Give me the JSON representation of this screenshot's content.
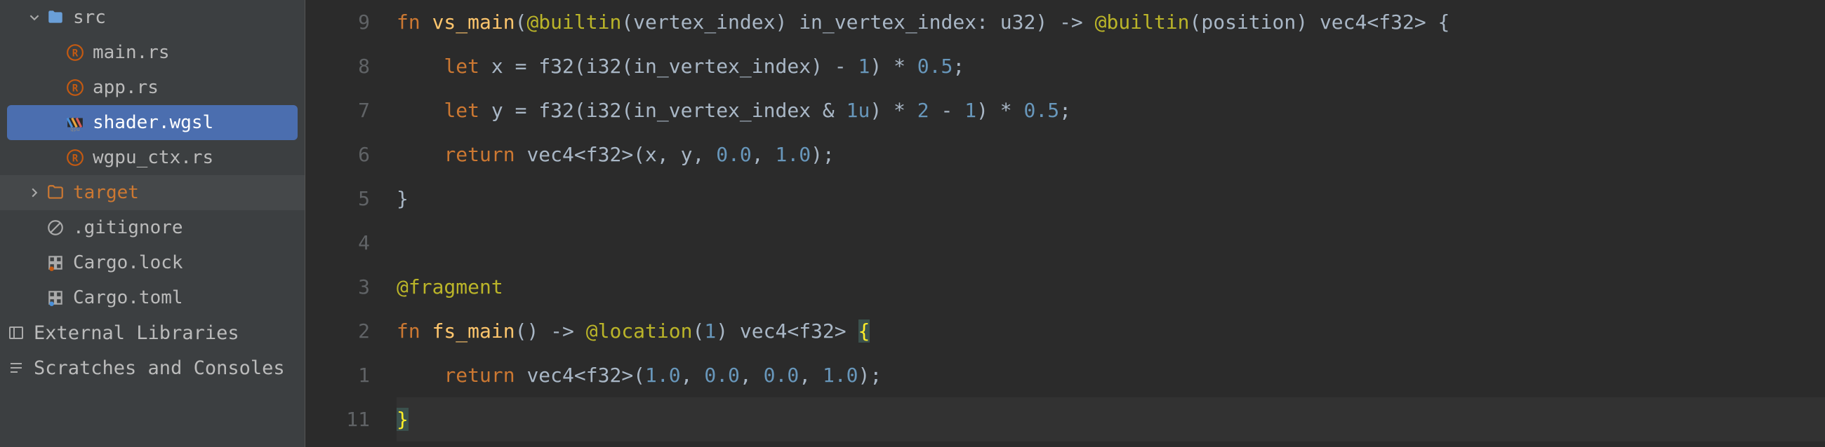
{
  "sidebar": {
    "items": [
      {
        "label": "src",
        "type": "folder",
        "expanded": true,
        "indent": 1,
        "color": "normal",
        "icon": "folder"
      },
      {
        "label": "main.rs",
        "type": "file",
        "indent": 2,
        "icon": "rust"
      },
      {
        "label": "app.rs",
        "type": "file",
        "indent": 2,
        "icon": "rust"
      },
      {
        "label": "shader.wgsl",
        "type": "file",
        "indent": 2,
        "icon": "shader",
        "selected": true
      },
      {
        "label": "wgpu_ctx.rs",
        "type": "file",
        "indent": 2,
        "icon": "rust"
      },
      {
        "label": "target",
        "type": "folder",
        "expanded": false,
        "indent": 1,
        "color": "orange",
        "icon": "folder-orange",
        "shaded": true
      },
      {
        "label": ".gitignore",
        "type": "file",
        "indent": 1,
        "icon": "ignore"
      },
      {
        "label": "Cargo.lock",
        "type": "file",
        "indent": 1,
        "icon": "lock"
      },
      {
        "label": "Cargo.toml",
        "type": "file",
        "indent": 1,
        "icon": "toml"
      }
    ],
    "external_libraries": "External Libraries",
    "scratches": "Scratches and Consoles"
  },
  "editor": {
    "gutter": [
      "9",
      "8",
      "7",
      "6",
      "5",
      "4",
      "3",
      "2",
      "1",
      "11"
    ],
    "lines": [
      {
        "tokens": [
          {
            "t": "fn ",
            "c": "keyword"
          },
          {
            "t": "vs_main",
            "c": "fn-name"
          },
          {
            "t": "(",
            "c": "paren"
          },
          {
            "t": "@builtin",
            "c": "string-attr"
          },
          {
            "t": "(",
            "c": "paren"
          },
          {
            "t": "vertex_index",
            "c": "ident"
          },
          {
            "t": ") ",
            "c": "paren"
          },
          {
            "t": "in_vertex_index",
            "c": "ident"
          },
          {
            "t": ": ",
            "c": "op"
          },
          {
            "t": "u32",
            "c": "type"
          },
          {
            "t": ") -> ",
            "c": "paren"
          },
          {
            "t": "@builtin",
            "c": "string-attr"
          },
          {
            "t": "(",
            "c": "paren"
          },
          {
            "t": "position",
            "c": "ident"
          },
          {
            "t": ") ",
            "c": "paren"
          },
          {
            "t": "vec4",
            "c": "type"
          },
          {
            "t": "<",
            "c": "op"
          },
          {
            "t": "f32",
            "c": "type"
          },
          {
            "t": "> {",
            "c": "paren"
          }
        ]
      },
      {
        "indent": "    ",
        "tokens": [
          {
            "t": "let ",
            "c": "keyword"
          },
          {
            "t": "x = ",
            "c": "ident"
          },
          {
            "t": "f32",
            "c": "type"
          },
          {
            "t": "(",
            "c": "paren"
          },
          {
            "t": "i32",
            "c": "type"
          },
          {
            "t": "(",
            "c": "paren"
          },
          {
            "t": "in_vertex_index",
            "c": "ident"
          },
          {
            "t": ") - ",
            "c": "paren"
          },
          {
            "t": "1",
            "c": "number"
          },
          {
            "t": ") * ",
            "c": "paren"
          },
          {
            "t": "0.5",
            "c": "number"
          },
          {
            "t": ";",
            "c": "op"
          }
        ]
      },
      {
        "indent": "    ",
        "tokens": [
          {
            "t": "let ",
            "c": "keyword"
          },
          {
            "t": "y = ",
            "c": "ident"
          },
          {
            "t": "f32",
            "c": "type"
          },
          {
            "t": "(",
            "c": "paren"
          },
          {
            "t": "i32",
            "c": "type"
          },
          {
            "t": "(",
            "c": "paren"
          },
          {
            "t": "in_vertex_index & ",
            "c": "ident"
          },
          {
            "t": "1u",
            "c": "number"
          },
          {
            "t": ") * ",
            "c": "paren"
          },
          {
            "t": "2",
            "c": "number"
          },
          {
            "t": " - ",
            "c": "op"
          },
          {
            "t": "1",
            "c": "number"
          },
          {
            "t": ") * ",
            "c": "paren"
          },
          {
            "t": "0.5",
            "c": "number"
          },
          {
            "t": ";",
            "c": "op"
          }
        ]
      },
      {
        "indent": "    ",
        "tokens": [
          {
            "t": "return ",
            "c": "keyword"
          },
          {
            "t": "vec4",
            "c": "type"
          },
          {
            "t": "<",
            "c": "op"
          },
          {
            "t": "f32",
            "c": "type"
          },
          {
            "t": ">(",
            "c": "paren"
          },
          {
            "t": "x",
            "c": "ident"
          },
          {
            "t": ", ",
            "c": "op"
          },
          {
            "t": "y",
            "c": "ident"
          },
          {
            "t": ", ",
            "c": "op"
          },
          {
            "t": "0.0",
            "c": "number"
          },
          {
            "t": ", ",
            "c": "op"
          },
          {
            "t": "1.0",
            "c": "number"
          },
          {
            "t": ");",
            "c": "paren"
          }
        ]
      },
      {
        "tokens": [
          {
            "t": "}",
            "c": "paren"
          }
        ]
      },
      {
        "tokens": []
      },
      {
        "tokens": [
          {
            "t": "@fragment",
            "c": "string-attr"
          }
        ]
      },
      {
        "tokens": [
          {
            "t": "fn ",
            "c": "keyword"
          },
          {
            "t": "fs_main",
            "c": "fn-name"
          },
          {
            "t": "() -> ",
            "c": "paren"
          },
          {
            "t": "@location",
            "c": "string-attr"
          },
          {
            "t": "(",
            "c": "paren"
          },
          {
            "t": "1",
            "c": "number"
          },
          {
            "t": ") ",
            "c": "paren"
          },
          {
            "t": "vec4",
            "c": "type"
          },
          {
            "t": "<",
            "c": "op"
          },
          {
            "t": "f32",
            "c": "type"
          },
          {
            "t": "> ",
            "c": "paren"
          },
          {
            "t": "{",
            "c": "highlight-brace"
          }
        ]
      },
      {
        "indent": "    ",
        "tokens": [
          {
            "t": "return ",
            "c": "keyword"
          },
          {
            "t": "vec4",
            "c": "type"
          },
          {
            "t": "<",
            "c": "op"
          },
          {
            "t": "f32",
            "c": "type"
          },
          {
            "t": ">(",
            "c": "paren"
          },
          {
            "t": "1.0",
            "c": "number"
          },
          {
            "t": ", ",
            "c": "op"
          },
          {
            "t": "0.0",
            "c": "number"
          },
          {
            "t": ", ",
            "c": "op"
          },
          {
            "t": "0.0",
            "c": "number"
          },
          {
            "t": ", ",
            "c": "op"
          },
          {
            "t": "1.0",
            "c": "number"
          },
          {
            "t": ");",
            "c": "paren"
          }
        ]
      },
      {
        "highlighted": true,
        "tokens": [
          {
            "t": "}",
            "c": "highlight-brace"
          }
        ]
      }
    ]
  }
}
